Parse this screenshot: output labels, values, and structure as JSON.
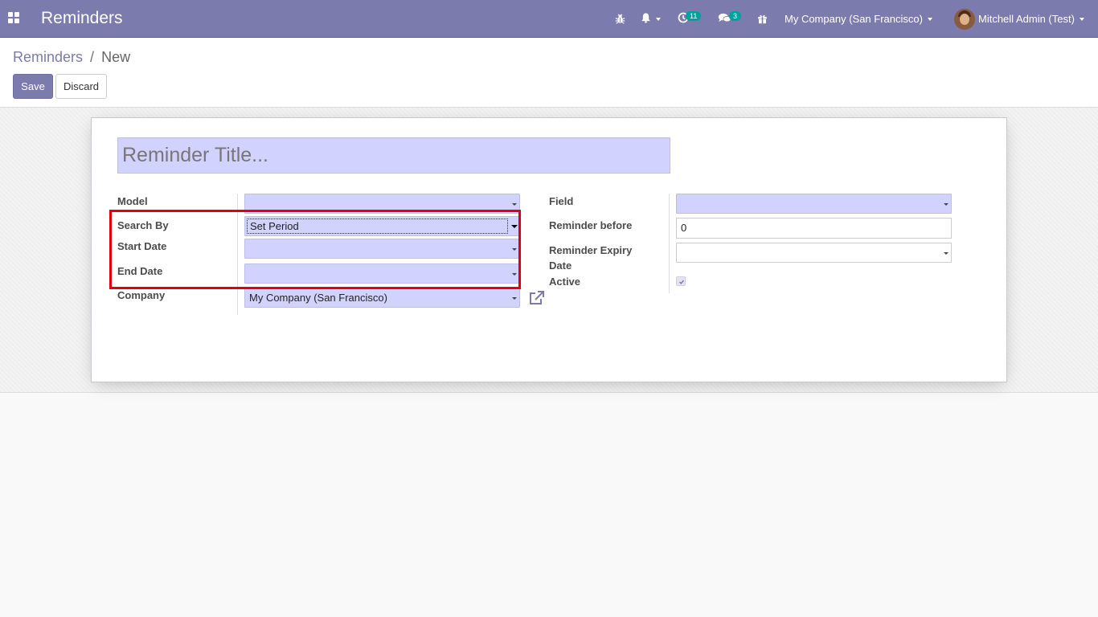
{
  "navbar": {
    "title": "Reminders",
    "icons": {
      "apps": "apps-grid-icon",
      "debug": "bug-icon",
      "notifications": "bell-icon",
      "activity": "clock-icon",
      "messages": "chat-bubbles-icon",
      "gift": "gift-icon"
    },
    "activity_count": "11",
    "messages_count": "3",
    "company": "My Company (San Francisco)",
    "user": "Mitchell Admin (Test)",
    "colors": {
      "navbar": "#7c7bad",
      "badge": "#00a09d"
    }
  },
  "breadcrumb": {
    "parent": "Reminders",
    "separator": "/",
    "current": "New"
  },
  "buttons": {
    "save": "Save",
    "discard": "Discard"
  },
  "form": {
    "title_placeholder": "Reminder Title...",
    "left": {
      "model_label": "Model",
      "model_value": "",
      "search_by_label": "Search By",
      "search_by_value": "Set Period",
      "start_date_label": "Start Date",
      "start_date_value": "",
      "end_date_label": "End Date",
      "end_date_value": "",
      "company_label": "Company",
      "company_value": "My Company (San Francisco)"
    },
    "right": {
      "field_label": "Field",
      "field_value": "",
      "reminder_before_label": "Reminder before",
      "reminder_before_value": "0",
      "expiry_label_line1": "Reminder Expiry",
      "expiry_label_line2": "Date",
      "expiry_value": "",
      "active_label": "Active",
      "active_checked": true
    },
    "colors": {
      "required_field": "#d2d2ff",
      "highlight_box": "#e2000f"
    }
  }
}
